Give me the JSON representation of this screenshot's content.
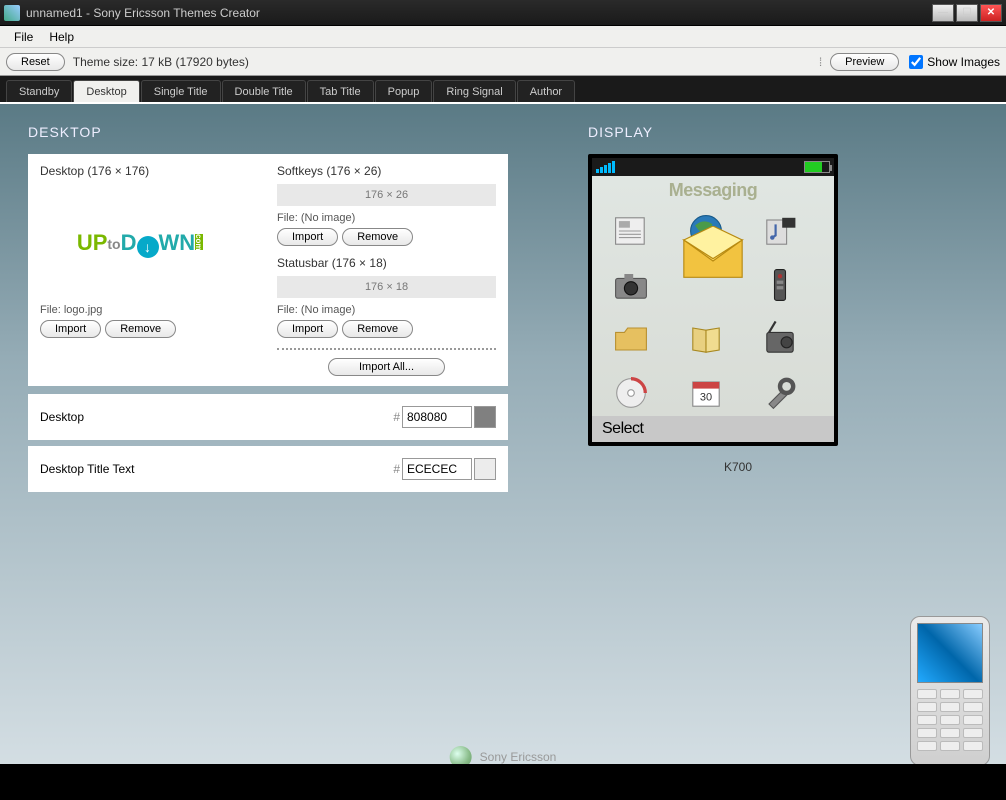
{
  "window": {
    "title": "unnamed1 - Sony Ericsson Themes Creator"
  },
  "menu": {
    "file": "File",
    "help": "Help"
  },
  "toolbar": {
    "reset": "Reset",
    "theme_size": "Theme size: 17 kB (17920 bytes)",
    "preview": "Preview",
    "show_images": "Show Images"
  },
  "tabs": [
    "Standby",
    "Desktop",
    "Single Title",
    "Double Title",
    "Tab Title",
    "Popup",
    "Ring Signal",
    "Author"
  ],
  "section": {
    "left": "DESKTOP",
    "right": "DISPLAY"
  },
  "desktop": {
    "label": "Desktop (176 × 176)",
    "file": "File: logo.jpg",
    "import": "Import",
    "remove": "Remove"
  },
  "softkeys": {
    "label": "Softkeys (176 × 26)",
    "placeholder": "176 × 26",
    "file": "File: (No image)",
    "import": "Import",
    "remove": "Remove"
  },
  "statusbar": {
    "label": "Statusbar (176 × 18)",
    "placeholder": "176 × 18",
    "file": "File: (No image)",
    "import": "Import",
    "remove": "Remove"
  },
  "import_all": "Import All...",
  "colors": {
    "desktop_label": "Desktop",
    "desktop_hex": "808080",
    "title_label": "Desktop Title Text",
    "title_hex": "ECECEC"
  },
  "phone": {
    "screen_title": "Messaging",
    "select": "Select",
    "model": "K700",
    "icons": [
      "news-icon",
      "globe-icon",
      "media-icon",
      "camera-icon",
      "mail-icon",
      "remote-icon",
      "folder-icon",
      "book-icon",
      "radio-icon",
      "cd-icon",
      "calendar-icon",
      "tools-icon"
    ]
  },
  "brand": "Sony Ericsson"
}
